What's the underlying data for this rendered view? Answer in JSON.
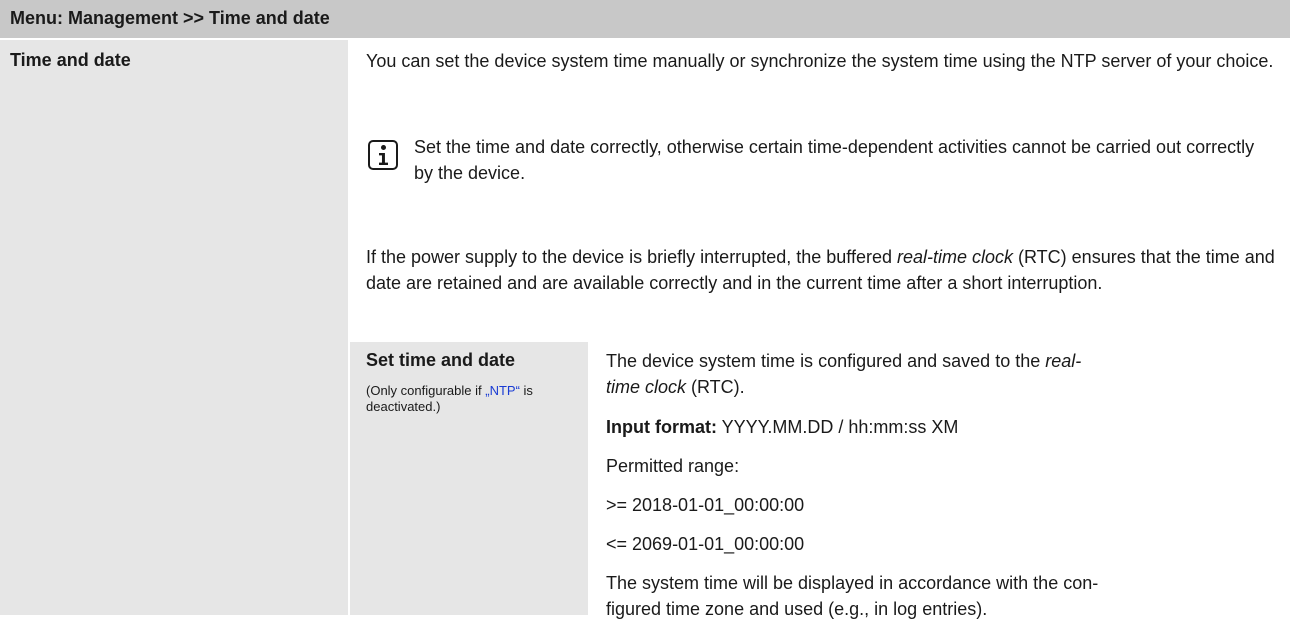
{
  "header": {
    "title": "Menu: Management >> Time and date"
  },
  "row": {
    "label": "Time and date",
    "intro": "You can set the device system time manually or synchronize the system time using the NTP server of your choice.",
    "note": "Set the time and date correctly, otherwise certain time-dependent activities cannot be carried out correctly by the device.",
    "rtc_para": {
      "before": "If the power supply to the device is briefly interrupted, the buffered ",
      "italic": "real-time clock",
      "after": " (RTC) ensures that the time and date are retained and are available correctly and in the current time after a short interruption."
    }
  },
  "subrow": {
    "label": "Set time and date",
    "note_before": "(Only configurable if ",
    "note_link": "„NTP“",
    "note_after": " is deactivated.)",
    "desc_before": "The device system time is configured and saved to the ",
    "desc_italic1": "real-",
    "desc_italic2": "time clock",
    "desc_after": " (RTC).",
    "input_format_label": "Input format:",
    "input_format_value": " YYYY.MM.DD / hh:mm:ss XM",
    "permitted_range_label": "Permitted range:",
    "range_min": ">= 2018-01-01_00:00:00",
    "range_max": "<= 2069-01-01_00:00:00",
    "display_line1": "The system time will be displayed in accordance with the con-",
    "display_line2": "figured time zone and used (e.g., in log entries)."
  },
  "icons": {
    "note_icon": "info-icon"
  },
  "colors": {
    "header_bg": "#c8c8c8",
    "label_bg": "#e6e6e6",
    "link": "#1a3cd4"
  }
}
